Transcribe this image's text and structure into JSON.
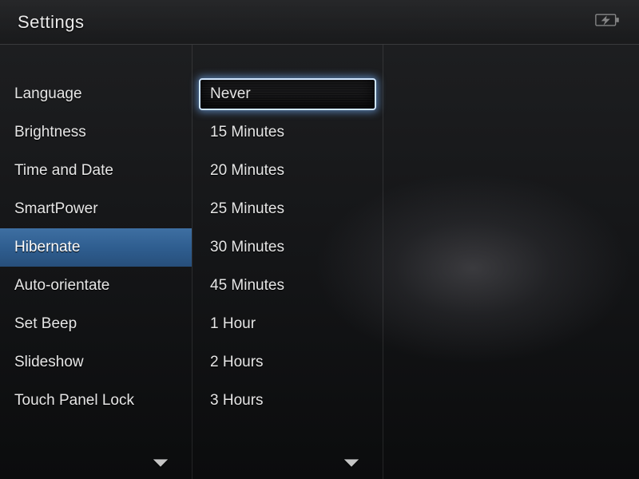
{
  "titlebar": {
    "title": "Settings"
  },
  "leftMenu": {
    "selectedIndex": 4,
    "items": [
      {
        "label": "Language"
      },
      {
        "label": "Brightness"
      },
      {
        "label": "Time and Date"
      },
      {
        "label": "SmartPower"
      },
      {
        "label": "Hibernate"
      },
      {
        "label": "Auto-orientate"
      },
      {
        "label": "Set Beep"
      },
      {
        "label": "Slideshow"
      },
      {
        "label": "Touch Panel Lock"
      }
    ]
  },
  "middleMenu": {
    "selectedIndex": 0,
    "items": [
      {
        "label": "Never"
      },
      {
        "label": "15 Minutes"
      },
      {
        "label": "20 Minutes"
      },
      {
        "label": "25 Minutes"
      },
      {
        "label": "30 Minutes"
      },
      {
        "label": "45 Minutes"
      },
      {
        "label": "1 Hour"
      },
      {
        "label": "2 Hours"
      },
      {
        "label": "3 Hours"
      }
    ]
  }
}
